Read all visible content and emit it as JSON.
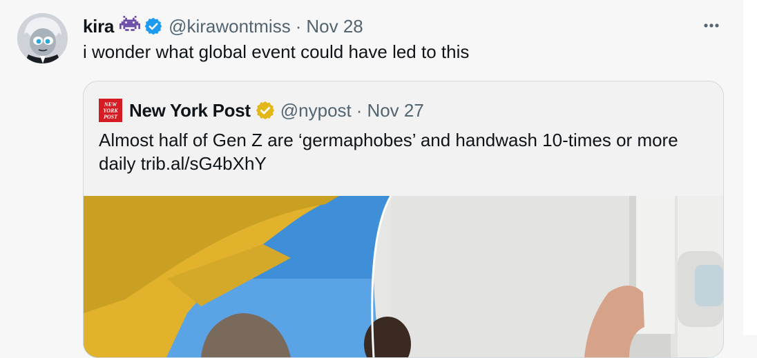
{
  "tweet": {
    "author": {
      "display_name": "kira",
      "handle": "@kirawontmiss",
      "badge_icon": "alien-monster-icon",
      "verified_icon": "blue-verified-icon"
    },
    "separator": "·",
    "date": "Nov 28",
    "text": "i wonder what global event could have led to this",
    "more_icon": "more-horizontal-icon"
  },
  "quoted_tweet": {
    "author": {
      "display_name": "New York Post",
      "handle": "@nypost",
      "logo_text": "NEW YORK POST",
      "verified_icon": "gold-verified-icon"
    },
    "separator": "·",
    "date": "Nov 27",
    "text": "Almost half of Gen Z are ‘germaphobes’ and handwash 10-times or more daily trib.al/sG4bXhY",
    "media": "photo-collage"
  },
  "colors": {
    "background": "#f7f7f7",
    "text_primary": "#0f1419",
    "text_secondary": "#536471",
    "verified_blue": "#1d9bf0",
    "verified_gold": "#e2b719",
    "nypost_red": "#d51c23"
  }
}
